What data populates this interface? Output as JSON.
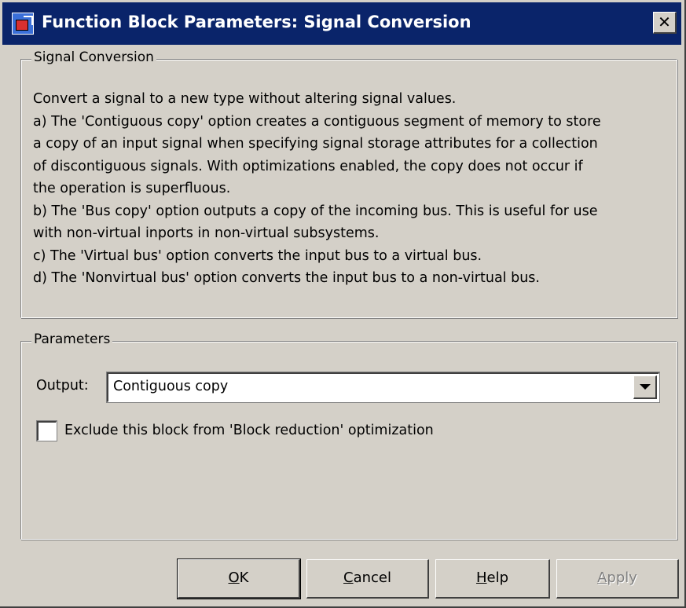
{
  "window": {
    "title": "Function Block Parameters: Signal Conversion",
    "close_glyph": "✕",
    "colors": {
      "titlebar": "#0a246a",
      "face": "#d4d0c8"
    }
  },
  "description_group": {
    "legend": "Signal Conversion",
    "lines": [
      "Convert a signal to a new type without altering signal values.",
      "a) The 'Contiguous copy' option creates a contiguous segment of memory to store",
      "a copy of an input signal when specifying signal storage attributes for a collection",
      "of discontiguous signals.  With optimizations enabled, the copy does not occur if",
      "the operation is superfluous.",
      "b) The 'Bus copy' option outputs a copy of the incoming bus. This is useful for use",
      "with non-virtual inports in non-virtual subsystems.",
      "c) The 'Virtual bus' option converts the input bus to a virtual bus.",
      "d) The 'Nonvirtual bus' option converts the input bus to a non-virtual bus."
    ]
  },
  "parameters_group": {
    "legend": "Parameters",
    "output_label": "Output:",
    "output_value": "Contiguous copy",
    "exclude_checkbox_label": "Exclude this block from 'Block reduction' optimization",
    "exclude_checked": false
  },
  "buttons": {
    "ok": {
      "mnemonic": "O",
      "rest": "K"
    },
    "cancel": {
      "mnemonic": "C",
      "rest": "ancel"
    },
    "help": {
      "mnemonic": "H",
      "rest": "elp"
    },
    "apply": {
      "mnemonic": "A",
      "rest": "pply",
      "disabled": true
    }
  }
}
